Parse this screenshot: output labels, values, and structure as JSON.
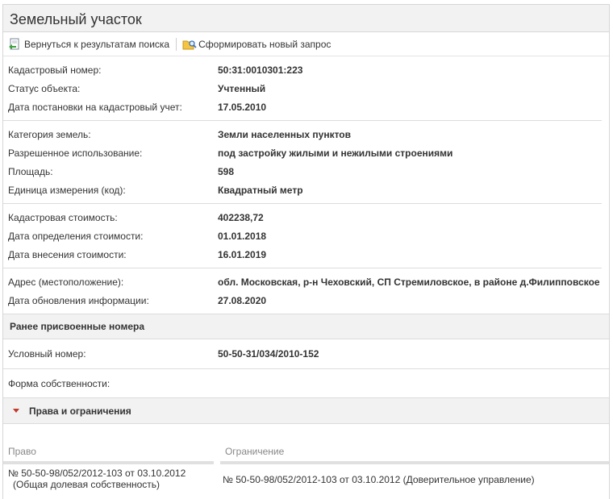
{
  "header": {
    "title": "Земельный участок"
  },
  "toolbar": {
    "back_label": "Вернуться к результатам поиска",
    "new_query_label": "Сформировать новый запрос"
  },
  "sections": [
    [
      {
        "label": "Кадастровый номер:",
        "value": "50:31:0010301:223"
      },
      {
        "label": "Статус объекта:",
        "value": "Учтенный"
      },
      {
        "label": "Дата постановки на кадастровый учет:",
        "value": "17.05.2010"
      }
    ],
    [
      {
        "label": "Категория земель:",
        "value": "Земли населенных пунктов"
      },
      {
        "label": "Разрешенное использование:",
        "value": "под застройку жилыми и нежилыми строениями"
      },
      {
        "label": "Площадь:",
        "value": "598"
      },
      {
        "label": "Единица измерения (код):",
        "value": "Квадратный метр"
      }
    ],
    [
      {
        "label": "Кадастровая стоимость:",
        "value": "402238,72"
      },
      {
        "label": "Дата определения стоимости:",
        "value": "01.01.2018"
      },
      {
        "label": "Дата внесения стоимости:",
        "value": "16.01.2019"
      }
    ],
    [
      {
        "label": "Адрес (местоположение):",
        "value": "обл. Московская, р-н Чеховский, СП Стремиловское, в районе д.Филипповское"
      },
      {
        "label": "Дата обновления информации:",
        "value": "27.08.2020"
      }
    ]
  ],
  "prior_numbers": {
    "heading": "Ранее присвоенные номера",
    "conditional_label": "Условный номер:",
    "conditional_value": "50-50-31/034/2010-152"
  },
  "ownership": {
    "label": "Форма собственности:"
  },
  "rights": {
    "heading": "Права и ограничения",
    "col_right": "Право",
    "col_restriction": "Ограничение",
    "rows": [
      {
        "right_line1": "№ 50-50-98/052/2012-103  от 03.10.2012",
        "right_line2": "(Общая долевая собственность)",
        "restriction": "№ 50-50-98/052/2012-103  от 03.10.2012  (Доверительное управление)"
      }
    ]
  },
  "colors": {
    "header_bg": "#f2f2f2",
    "border": "#d6d6d6",
    "arrow": "#c0392b"
  },
  "icons": {
    "back": "back-arrow-icon",
    "new_query": "folder-search-icon",
    "expand": "triangle-down-icon"
  }
}
